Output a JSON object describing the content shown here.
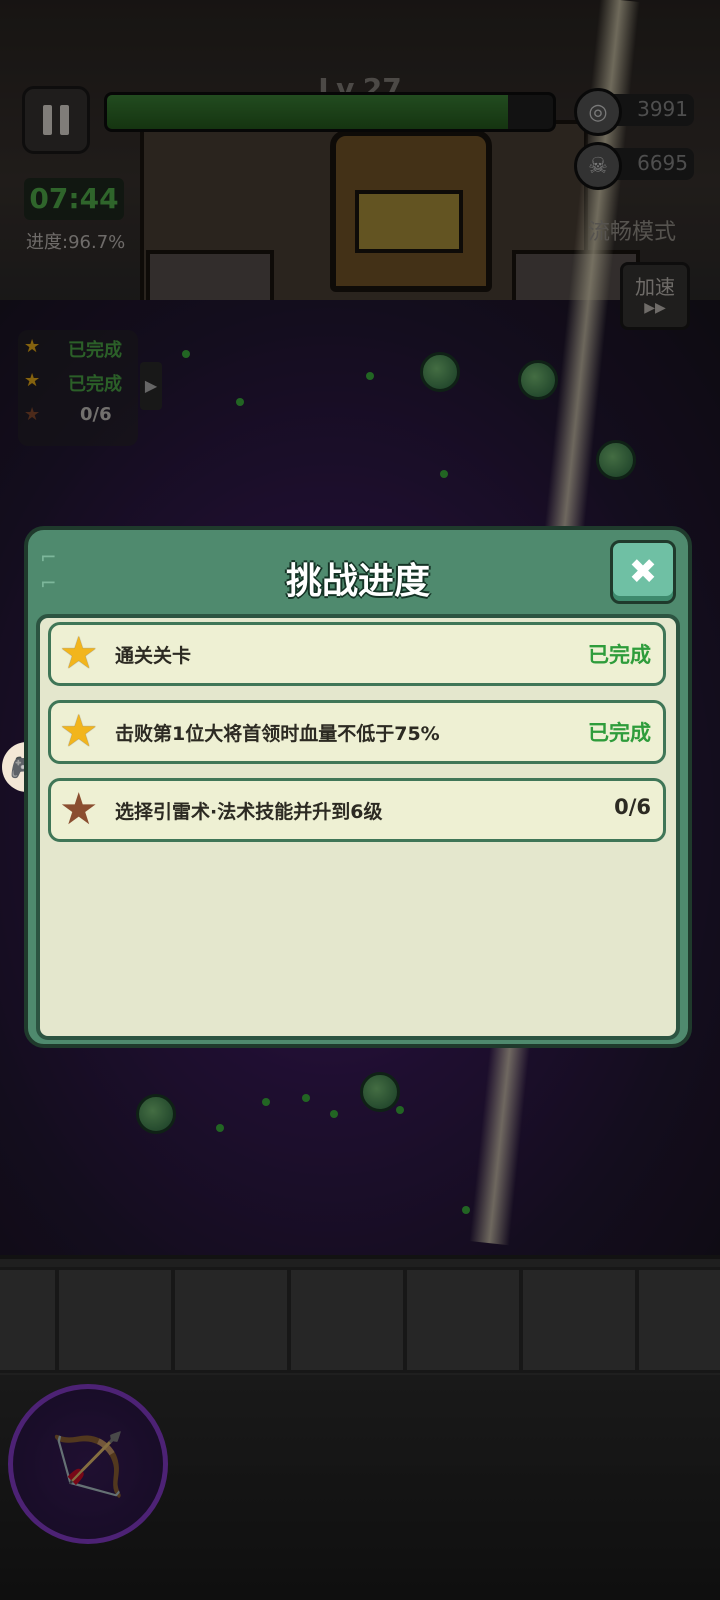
{
  "hud": {
    "level": "Lv.27",
    "xp_fraction": 0.9,
    "coins": "3991",
    "kills": "6695",
    "timer": "07:44",
    "progress": "进度:96.7%",
    "mode": "流畅模式",
    "speed_label": "加速",
    "speed_arrow": "▶▶"
  },
  "mini_tracker": {
    "rows": [
      {
        "label": "已完成",
        "star": "gold"
      },
      {
        "label": "已完成",
        "star": "gold"
      },
      {
        "label": "0/6",
        "star": "bronze"
      }
    ]
  },
  "dialog": {
    "title": "挑战进度",
    "close_glyph": "✖",
    "items": [
      {
        "text": "通关关卡",
        "status": "已完成",
        "star": "gold"
      },
      {
        "text": "击败第1位大将首领时血量不低于75%",
        "status": "已完成",
        "star": "gold"
      },
      {
        "text": "选择引雷术·法术技能并升到6级",
        "status": "0/6",
        "star": "bronze"
      }
    ]
  },
  "colors": {
    "dialog_green": "#4f8a6e",
    "complete_green": "#2e9c3b",
    "skill_ring": "#8d3fd6"
  },
  "icons": {
    "pause": "pause-icon",
    "coin": "coin-icon",
    "skull": "skull-icon",
    "star": "star-icon",
    "close": "close-icon",
    "gamepad": "gamepad-icon",
    "bow": "bow-icon"
  }
}
